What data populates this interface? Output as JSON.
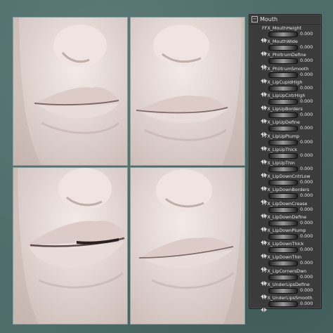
{
  "panel": {
    "title": "Mouth",
    "collapse_symbol": "−"
  },
  "morphs": [
    {
      "label": "FFX_MouthHeight",
      "value": "0.000"
    },
    {
      "label": "FFX_MouthWide",
      "value": "0.000"
    },
    {
      "label": "FFX_PhiltrumDefine",
      "value": "0.000"
    },
    {
      "label": "FFX_PhiltrumSmooth",
      "value": "0.000"
    },
    {
      "label": "FFX_LipCupidHigh",
      "value": "0.000"
    },
    {
      "label": "FFX_LipUpCntrHigh",
      "value": "0.000"
    },
    {
      "label": "FFX_LipUpBorders",
      "value": "0.000"
    },
    {
      "label": "FFX_LipUpDefine",
      "value": "0.000"
    },
    {
      "label": "FFX_LipUpPlump",
      "value": "0.000"
    },
    {
      "label": "FFX_LipUpThick",
      "value": "0.000"
    },
    {
      "label": "FFX_LipUpThin",
      "value": "0.000"
    },
    {
      "label": "FFX_LipDownCntrLow",
      "value": "0.000"
    },
    {
      "label": "FFX_LipDownBorders",
      "value": "0.000"
    },
    {
      "label": "FFX_LipDownCrease",
      "value": "0.000"
    },
    {
      "label": "FFX_LipDownDefine",
      "value": "0.000"
    },
    {
      "label": "FFX_LipDownPlump",
      "value": "0.000"
    },
    {
      "label": "FFX_LipDownThick",
      "value": "0.000"
    },
    {
      "label": "FFX_LipDownThin",
      "value": "0.000"
    },
    {
      "label": "FFX_LipCornersDwn",
      "value": "0.000"
    },
    {
      "label": "FFX_UnderLipsDefine",
      "value": "0.000"
    },
    {
      "label": "FFX_UnderLipsSmooth",
      "value": "0.000"
    }
  ],
  "colors": {
    "background": "#4f6c6a",
    "skin": "#e7dbd7",
    "panel": "#3b3b3b"
  }
}
